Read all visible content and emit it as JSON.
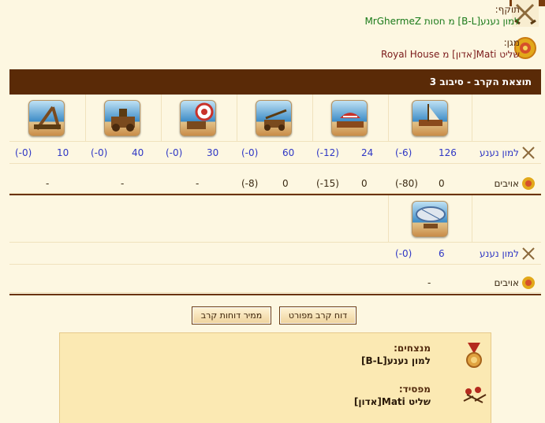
{
  "header": {
    "attacker_label": "תוקף:",
    "attacker_line": "למון נענע[B-L] מ חסות MrGhermeZ",
    "defender_label": "מגן:",
    "defender_line": "שליט Mati[אדון] מ Royal House"
  },
  "result_bar": "תוצאת הקרב - סיבוב 3",
  "attacker_name": "למון נענע",
  "enemy_name": "אויבים",
  "units_row1": [
    {
      "count": "126",
      "loss": "(-6)",
      "enemy_count": "0",
      "enemy_loss": "(-80)"
    },
    {
      "count": "24",
      "loss": "(-12)",
      "enemy_count": "0",
      "enemy_loss": "(-15)"
    },
    {
      "count": "60",
      "loss": "(-0)",
      "enemy_count": "0",
      "enemy_loss": "(-8)"
    },
    {
      "count": "30",
      "loss": "(-0)",
      "enemy_count": "-",
      "enemy_loss": ""
    },
    {
      "count": "40",
      "loss": "(-0)",
      "enemy_count": "-",
      "enemy_loss": ""
    },
    {
      "count": "10",
      "loss": "(-0)",
      "enemy_count": "-",
      "enemy_loss": ""
    }
  ],
  "units_row2": [
    {
      "count": "6",
      "loss": "(-0)",
      "enemy_count": "-"
    }
  ],
  "buttons": {
    "detailed": "דוח קרב מפורט",
    "converter": "ממיר דוחות קרב"
  },
  "summary": {
    "winners_label": "מנצחים:",
    "winners_value": "למון נענע[B-L]",
    "loser_label": "מפסיד:",
    "loser_value": "שליט Mati[אדון]"
  },
  "colors": {
    "bar": "#5a2a07",
    "count": "#2f37c5",
    "attacker_line": "#1a7a1a",
    "defender_line": "#7a1a1a"
  }
}
